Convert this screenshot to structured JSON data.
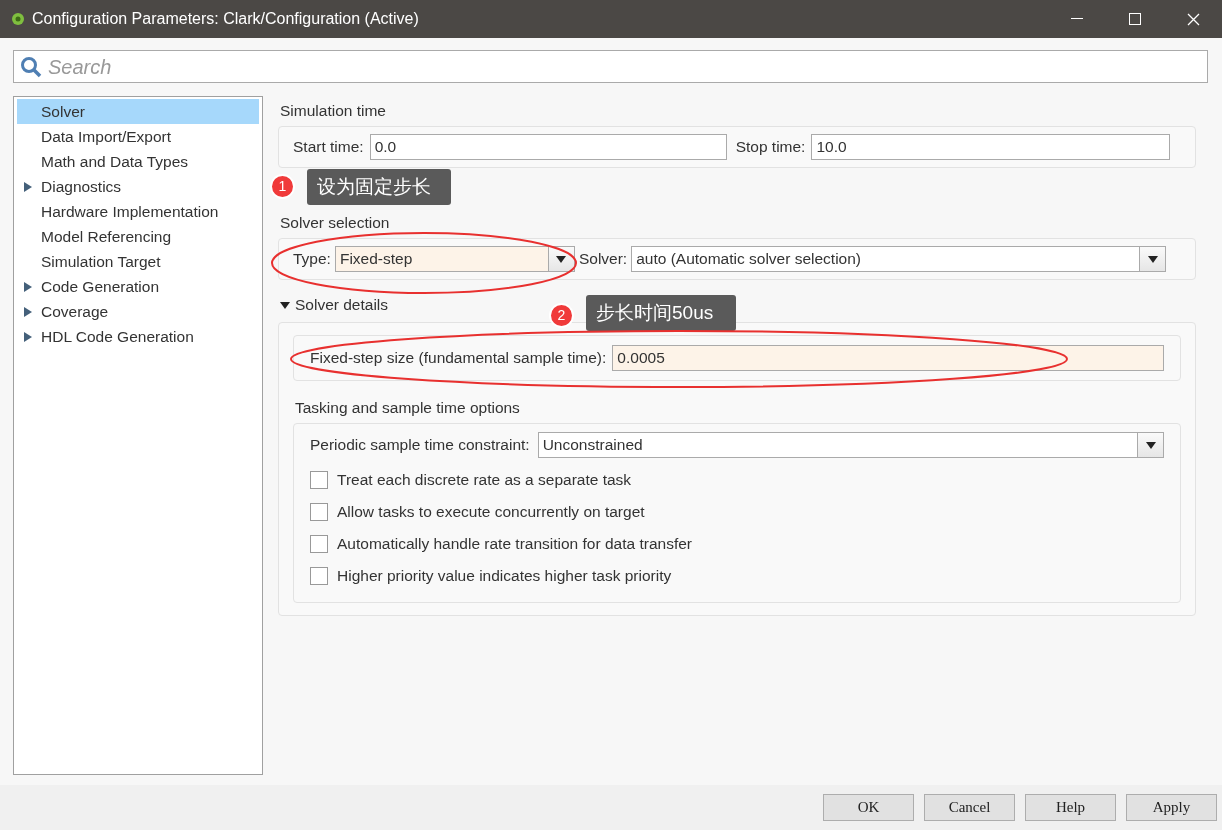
{
  "window": {
    "title": "Configuration Parameters: Clark/Configuration (Active)"
  },
  "search": {
    "placeholder": "Search"
  },
  "sidebar": {
    "items": [
      {
        "label": "Solver",
        "selected": true,
        "kind": "leaf"
      },
      {
        "label": "Data Import/Export",
        "selected": false,
        "kind": "leaf"
      },
      {
        "label": "Math and Data Types",
        "selected": false,
        "kind": "leaf"
      },
      {
        "label": "Diagnostics",
        "selected": false,
        "kind": "group"
      },
      {
        "label": "Hardware Implementation",
        "selected": false,
        "kind": "leaf"
      },
      {
        "label": "Model Referencing",
        "selected": false,
        "kind": "leaf"
      },
      {
        "label": "Simulation Target",
        "selected": false,
        "kind": "leaf"
      },
      {
        "label": "Code Generation",
        "selected": false,
        "kind": "group"
      },
      {
        "label": "Coverage",
        "selected": false,
        "kind": "group"
      },
      {
        "label": "HDL Code Generation",
        "selected": false,
        "kind": "group"
      }
    ]
  },
  "simulation_time": {
    "title": "Simulation time",
    "fields": [
      {
        "label": "Start time:",
        "value": "0.0"
      },
      {
        "label": "Stop time:",
        "value": "10.0"
      }
    ]
  },
  "solver_selection": {
    "title": "Solver selection",
    "fields": [
      {
        "label": "Type:",
        "value": "Fixed-step",
        "highlighted": true
      },
      {
        "label": "Solver:",
        "value": "auto (Automatic solver selection)",
        "highlighted": false
      }
    ]
  },
  "solver_details": {
    "title": "Solver details",
    "expanded": true,
    "step_size": {
      "label": "Fixed-step size (fundamental sample time):",
      "value": "0.0005",
      "highlighted": true
    },
    "tasking": {
      "title": "Tasking and sample time options",
      "constraint": {
        "label": "Periodic sample time constraint:",
        "value": "Unconstrained"
      },
      "options": [
        {
          "label": "Treat each discrete rate as a separate task",
          "checked": false
        },
        {
          "label": "Allow tasks to execute concurrently on target",
          "checked": false
        },
        {
          "label": "Automatically handle rate transition for data transfer",
          "checked": false
        },
        {
          "label": "Higher priority value indicates higher task priority",
          "checked": false
        }
      ]
    }
  },
  "annotations": [
    {
      "number": "1",
      "text": "设为固定步长"
    },
    {
      "number": "2",
      "text": "步长时间50us"
    }
  ],
  "buttons": [
    {
      "label": "OK"
    },
    {
      "label": "Cancel"
    },
    {
      "label": "Help"
    },
    {
      "label": "Apply"
    }
  ]
}
